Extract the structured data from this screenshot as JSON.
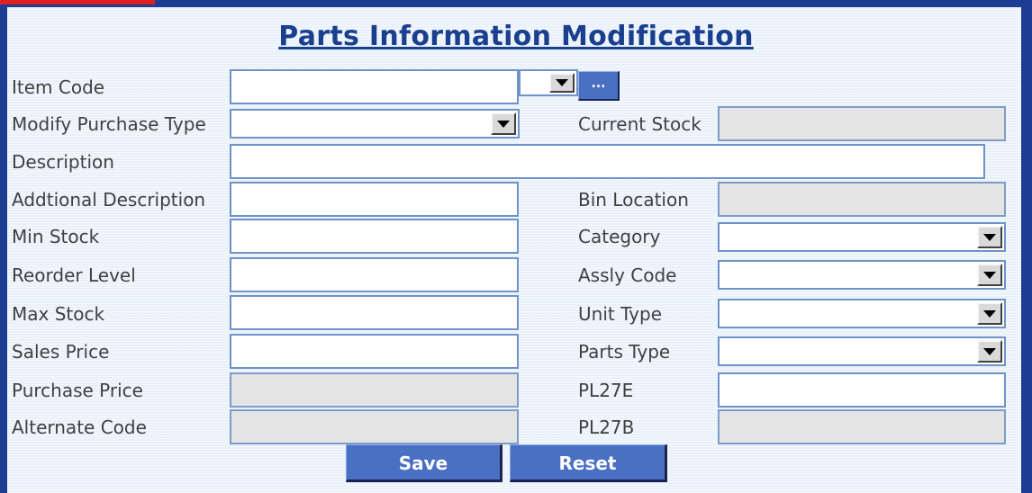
{
  "form": {
    "title": "Parts Information Modification",
    "labels": {
      "item_code": "Item Code",
      "modify_purchase_type": "Modify Purchase Type",
      "current_stock": "Current Stock",
      "description": "Description",
      "additional_description": "Addtional Description",
      "bin_location": "Bin Location",
      "min_stock": "Min Stock",
      "category": "Category",
      "reorder_level": "Reorder Level",
      "assly_code": "Assly Code",
      "max_stock": "Max Stock",
      "unit_type": "Unit Type",
      "sales_price": "Sales Price",
      "parts_type": "Parts Type",
      "purchase_price": "Purchase Price",
      "pl27e": "PL27E",
      "alternate_code": "Alternate Code",
      "pl27b": "PL27B"
    },
    "values": {
      "item_code": "",
      "modify_purchase_type": "",
      "current_stock": "",
      "description": "",
      "additional_description": "",
      "bin_location": "",
      "min_stock": "",
      "category": "",
      "reorder_level": "",
      "assly_code": "",
      "max_stock": "",
      "unit_type": "",
      "sales_price": "",
      "parts_type": "",
      "purchase_price": "",
      "pl27e": "",
      "alternate_code": "",
      "pl27b": "",
      "item_code_dropdown": ""
    },
    "browse_button_label": "...",
    "save_label": "Save",
    "reset_label": "Reset"
  },
  "icons": {
    "dropdown": "dropdown-arrow-icon"
  },
  "colors": {
    "frame": "#1e3c94",
    "title": "#1a3f8f",
    "button": "#4a70c4",
    "field_border": "#6f92c8",
    "readonly_field": "#e4e4e4",
    "accent_red": "#e02020"
  }
}
